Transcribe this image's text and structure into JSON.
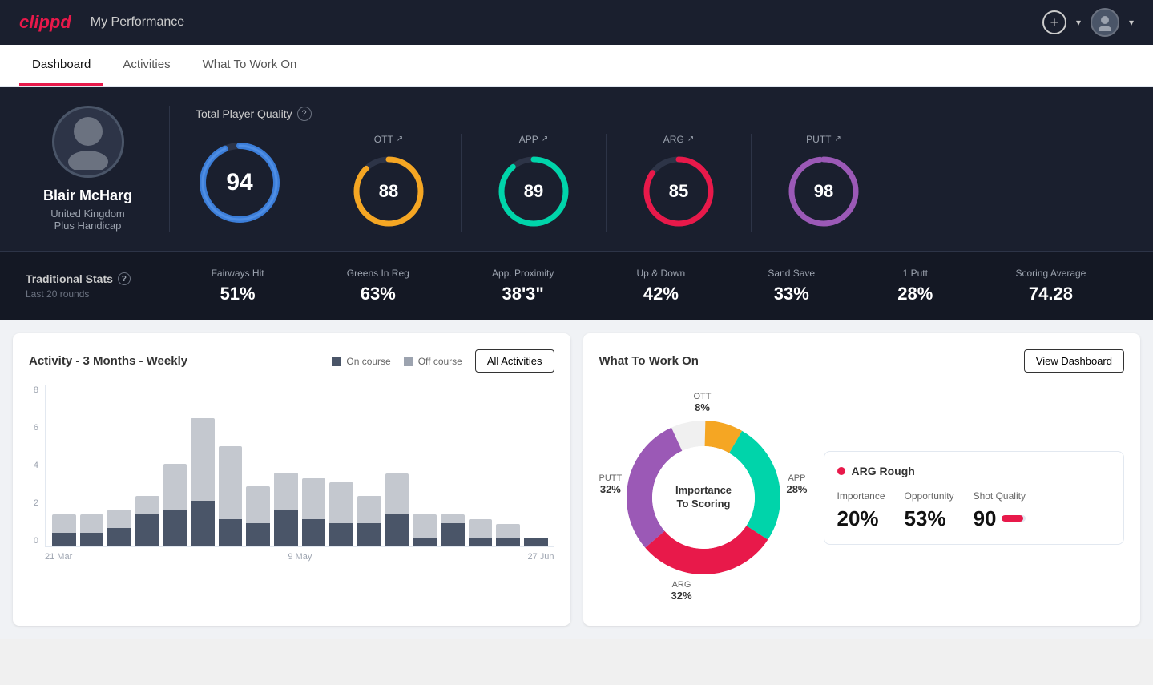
{
  "header": {
    "logo": "clippd",
    "title": "My Performance",
    "add_icon": "+",
    "add_label": "▾",
    "avatar_label": "▾"
  },
  "nav": {
    "tabs": [
      "Dashboard",
      "Activities",
      "What To Work On"
    ],
    "active": "Dashboard"
  },
  "player": {
    "name": "Blair McHarg",
    "country": "United Kingdom",
    "handicap": "Plus Handicap"
  },
  "quality": {
    "label": "Total Player Quality",
    "main_score": 94,
    "scores": [
      {
        "label": "OTT",
        "value": 88,
        "color_start": "#f5a623",
        "color_end": "#e8c44a",
        "track": "#2d3447"
      },
      {
        "label": "APP",
        "value": 89,
        "color_start": "#00d4aa",
        "color_end": "#00b899",
        "track": "#2d3447"
      },
      {
        "label": "ARG",
        "value": 85,
        "color_start": "#e8194a",
        "color_end": "#ff6b8a",
        "track": "#2d3447"
      },
      {
        "label": "PUTT",
        "value": 98,
        "color_start": "#9b59b6",
        "color_end": "#7c3aed",
        "track": "#2d3447"
      }
    ]
  },
  "traditional_stats": {
    "label": "Traditional Stats",
    "sub_label": "Last 20 rounds",
    "stats": [
      {
        "name": "Fairways Hit",
        "value": "51%"
      },
      {
        "name": "Greens In Reg",
        "value": "63%"
      },
      {
        "name": "App. Proximity",
        "value": "38'3\""
      },
      {
        "name": "Up & Down",
        "value": "42%"
      },
      {
        "name": "Sand Save",
        "value": "33%"
      },
      {
        "name": "1 Putt",
        "value": "28%"
      },
      {
        "name": "Scoring Average",
        "value": "74.28"
      }
    ]
  },
  "activity_chart": {
    "title": "Activity - 3 Months - Weekly",
    "legend_on_course": "On course",
    "legend_off_course": "Off course",
    "all_activities_btn": "All Activities",
    "x_labels": [
      "21 Mar",
      "9 May",
      "27 Jun"
    ],
    "y_labels": [
      "8",
      "6",
      "4",
      "2",
      "0"
    ],
    "bars": [
      {
        "on": 15,
        "off": 20
      },
      {
        "on": 15,
        "off": 20
      },
      {
        "on": 20,
        "off": 20
      },
      {
        "on": 35,
        "off": 20
      },
      {
        "on": 40,
        "off": 50
      },
      {
        "on": 50,
        "off": 90
      },
      {
        "on": 30,
        "off": 80
      },
      {
        "on": 25,
        "off": 40
      },
      {
        "on": 40,
        "off": 40
      },
      {
        "on": 30,
        "off": 45
      },
      {
        "on": 25,
        "off": 45
      },
      {
        "on": 25,
        "off": 30
      },
      {
        "on": 35,
        "off": 45
      },
      {
        "on": 10,
        "off": 25
      },
      {
        "on": 25,
        "off": 10
      },
      {
        "on": 10,
        "off": 20
      },
      {
        "on": 10,
        "off": 15
      },
      {
        "on": 10,
        "off": 0
      }
    ]
  },
  "what_to_work_on": {
    "title": "What To Work On",
    "view_dashboard_btn": "View Dashboard",
    "center_text_1": "Importance",
    "center_text_2": "To Scoring",
    "segments": [
      {
        "label": "OTT",
        "pct": "8%",
        "color": "#f5a623"
      },
      {
        "label": "APP",
        "pct": "28%",
        "color": "#00d4aa"
      },
      {
        "label": "ARG",
        "pct": "32%",
        "color": "#e8194a"
      },
      {
        "label": "PUTT",
        "pct": "32%",
        "color": "#9b59b6"
      }
    ],
    "arg_card": {
      "title": "ARG Rough",
      "importance_label": "Importance",
      "importance_value": "20%",
      "opportunity_label": "Opportunity",
      "opportunity_value": "53%",
      "shot_quality_label": "Shot Quality",
      "shot_quality_value": "90"
    }
  }
}
